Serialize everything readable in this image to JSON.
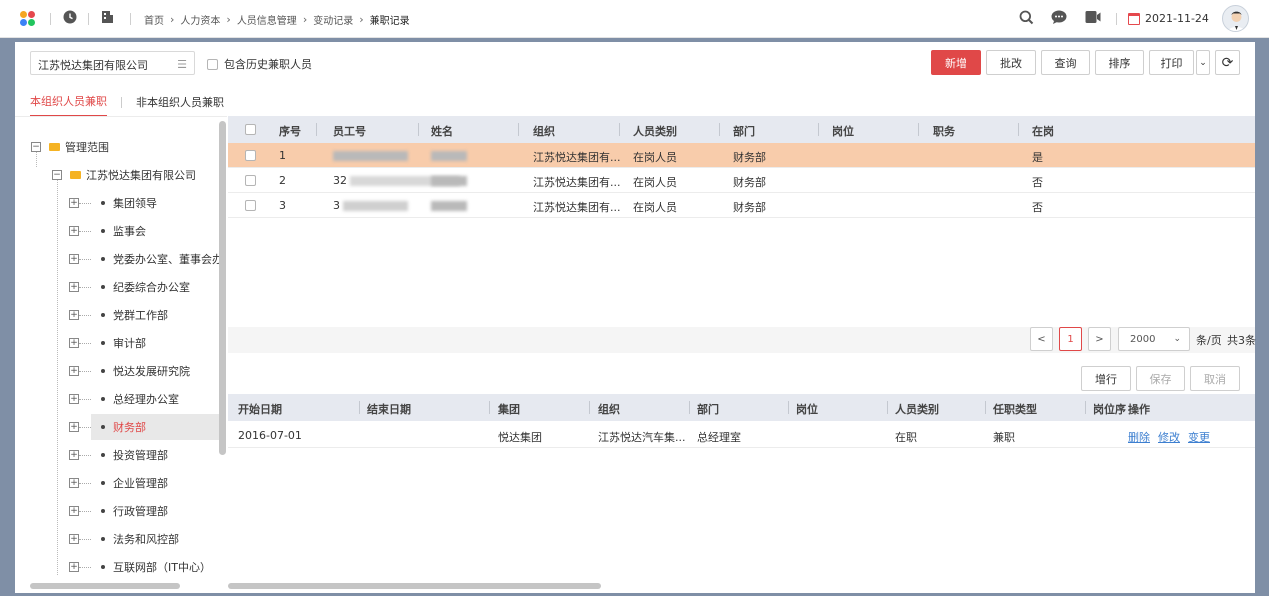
{
  "topbar": {
    "breadcrumb": [
      "首页",
      "人力资本",
      "人员信息管理",
      "变动记录",
      "兼职记录"
    ],
    "date": "2021-11-24"
  },
  "toolbar": {
    "org_select": "江苏悦达集团有限公司",
    "include_history_label": "包含历史兼职人员",
    "buttons": {
      "new": "新增",
      "batch_edit": "批改",
      "query": "查询",
      "sort": "排序",
      "print": "打印"
    }
  },
  "tabs": [
    "本组织人员兼职",
    "非本组织人员兼职"
  ],
  "tree": {
    "root": "管理范围",
    "company": "江苏悦达集团有限公司",
    "departments": [
      "集团领导",
      "监事会",
      "党委办公室、董事会办",
      "纪委综合办公室",
      "党群工作部",
      "审计部",
      "悦达发展研究院",
      "总经理办公室",
      "财务部",
      "投资管理部",
      "企业管理部",
      "行政管理部",
      "法务和风控部",
      "互联网部（IT中心）"
    ],
    "selected": "财务部"
  },
  "employees": {
    "columns": [
      "序号",
      "员工号",
      "姓名",
      "组织",
      "人员类别",
      "部门",
      "岗位",
      "职务",
      "在岗"
    ],
    "rows": [
      {
        "no": "1",
        "emp_id": "",
        "name": "",
        "org": "江苏悦达集团有...",
        "category": "在岗人员",
        "dept": "财务部",
        "post": "",
        "duty": "",
        "on_duty": "是"
      },
      {
        "no": "2",
        "emp_id": "32",
        "name": "",
        "org": "江苏悦达集团有...",
        "category": "在岗人员",
        "dept": "财务部",
        "post": "",
        "duty": "",
        "on_duty": "否"
      },
      {
        "no": "3",
        "emp_id": "3",
        "name": "",
        "org": "江苏悦达集团有...",
        "category": "在岗人员",
        "dept": "财务部",
        "post": "",
        "duty": "",
        "on_duty": "否"
      }
    ]
  },
  "pager": {
    "prev": "<",
    "page": "1",
    "next": ">",
    "page_size": "2000",
    "per_page_label": "条/页",
    "total_label": "共3条"
  },
  "detail_toolbar": {
    "add_row": "增行",
    "save": "保存",
    "cancel": "取消"
  },
  "parttime": {
    "columns": [
      "开始日期",
      "结束日期",
      "集团",
      "组织",
      "部门",
      "岗位",
      "人员类别",
      "任职类型",
      "岗位序",
      "操作"
    ],
    "rows": [
      {
        "start": "2016-07-01",
        "end": "",
        "group": "悦达集团",
        "org": "江苏悦达汽车集...",
        "dept": "总经理室",
        "post": "",
        "category": "在职",
        "type": "兼职",
        "seq": "",
        "actions": [
          "删除",
          "修改",
          "变更"
        ]
      }
    ]
  },
  "colors": {
    "accent": "#e04848",
    "selected_row": "#f8ccab",
    "link": "#3d7fd0"
  }
}
